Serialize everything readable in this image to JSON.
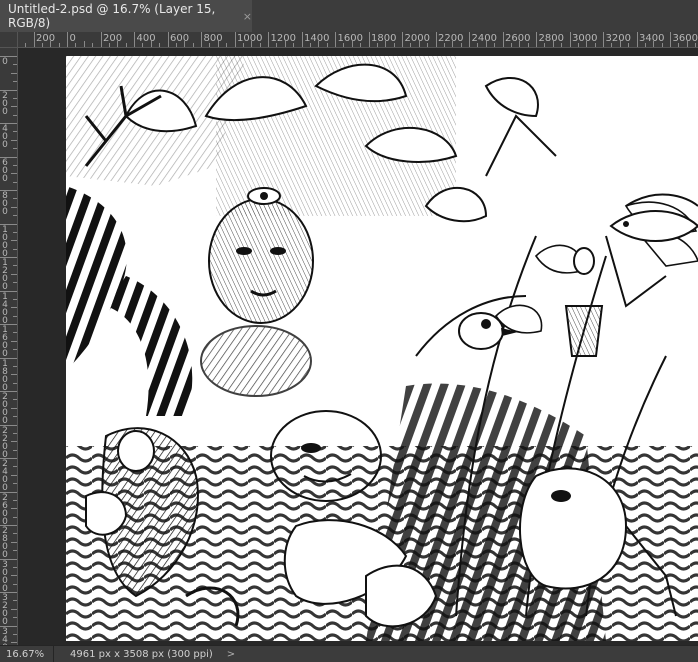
{
  "document_tab": {
    "title": "Untitled-2.psd @ 16.7% (Layer 15, RGB/8)",
    "close_glyph": "×"
  },
  "horizontal_ruler": {
    "labels": [
      "200",
      "0",
      "200",
      "400",
      "600",
      "800",
      "1000",
      "1200",
      "1400",
      "1600",
      "1800",
      "2000",
      "2200",
      "2400",
      "2600",
      "2800",
      "3000",
      "3200",
      "3400",
      "3600"
    ]
  },
  "vertical_ruler": {
    "labels": [
      "0",
      "200",
      "400",
      "600",
      "800",
      "1000",
      "1200",
      "1400",
      "1600",
      "1800",
      "2000",
      "2200",
      "2400",
      "2600",
      "2800",
      "3000",
      "3200",
      "3400"
    ]
  },
  "canvas": {
    "artwork": "black-and-white-ink-illustration",
    "paper_color": "#ffffff",
    "ink_color": "#111111"
  },
  "status_bar": {
    "zoom": "16.67%",
    "doc_info": "4961 px x 3508 px (300 ppi)",
    "arrow": ">"
  },
  "colors": {
    "workspace": "#282828",
    "panel": "#3c3c3c",
    "ruler": "#3a3a3a",
    "tab_active": "#4a4a4a"
  }
}
